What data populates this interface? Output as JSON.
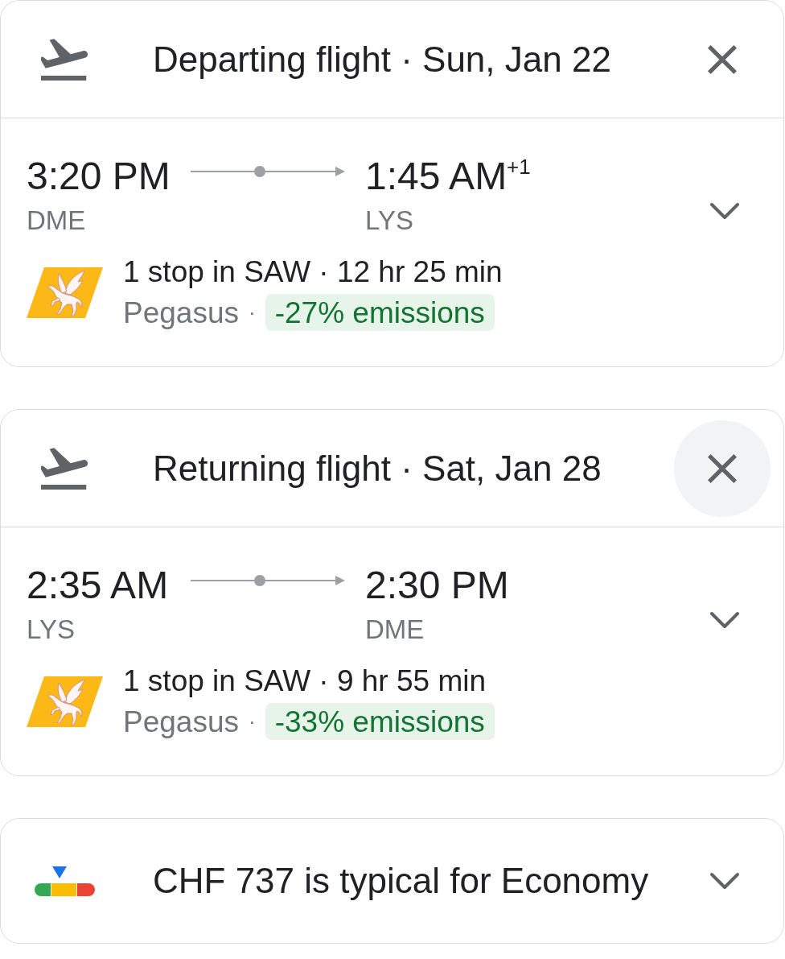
{
  "flights": [
    {
      "title": "Departing flight · Sun, Jan 22",
      "close_hovered": false,
      "depart_time": "3:20 PM",
      "depart_airport": "DME",
      "arrive_time": "1:45 AM$^{+1}$",
      "arrive_airport": "LYS",
      "expanded": false,
      "stops": "1 stop in SAW · 12 hr 25 min",
      "airline": "Pegasus",
      "separator": "·",
      "emissions": "-27% emissions"
    },
    {
      "title": "Returning flight · Sat, Jan 28",
      "close_hovered": true,
      "depart_time": "2:35 AM",
      "depart_airport": "LYS",
      "arrive_time": "2:30 PM",
      "arrive_airport": "DME",
      "expanded": false,
      "stops": "1 stop in SAW · 9 hr 55 min",
      "airline": "Pegasus",
      "separator": "·",
      "emissions": "-33% emissions"
    }
  ],
  "price_insight": {
    "text": "CHF 737 is typical for Economy",
    "expanded": false
  }
}
